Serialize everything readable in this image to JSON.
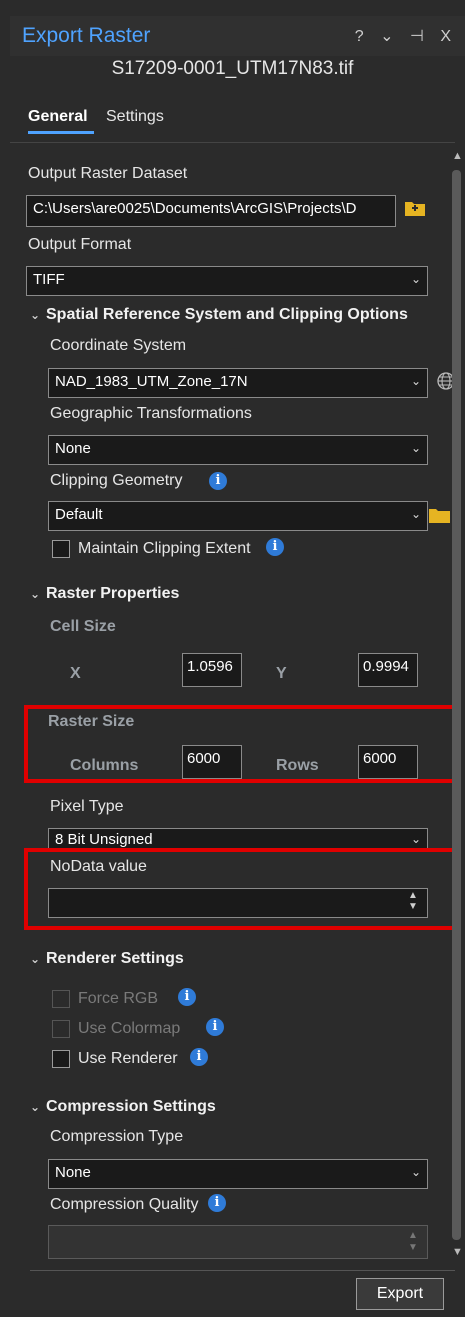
{
  "window": {
    "title": "Export Raster",
    "controls": "? ⌄ ⊣ X",
    "filename": "S17209-0001_UTM17N83.tif"
  },
  "tabs": [
    {
      "label": "General",
      "active": true
    },
    {
      "label": "Settings",
      "active": false
    }
  ],
  "output": {
    "raster_label": "Output Raster Dataset",
    "raster_value": "C:\\Users\\are0025\\Documents\\ArcGIS\\Projects\\D",
    "format_label": "Output Format",
    "format_value": "TIFF"
  },
  "spatial": {
    "section_label": "Spatial Reference System and Clipping Options",
    "coord_label": "Coordinate System",
    "coord_value": "NAD_1983_UTM_Zone_17N",
    "geo_label": "Geographic Transformations",
    "geo_value": "None",
    "clip_label": "Clipping Geometry",
    "clip_value": "Default",
    "maintain_label": "Maintain Clipping Extent"
  },
  "raster_props": {
    "section_label": "Raster Properties",
    "cell_size_label": "Cell Size",
    "x_label": "X",
    "x_value": "1.0596",
    "y_label": "Y",
    "y_value": "0.9994",
    "raster_size_label": "Raster Size",
    "columns_label": "Columns",
    "columns_value": "6000",
    "rows_label": "Rows",
    "rows_value": "6000",
    "pixel_type_label": "Pixel Type",
    "pixel_type_value": "8 Bit Unsigned",
    "nodata_label": "NoData value",
    "nodata_value": ""
  },
  "renderer": {
    "section_label": "Renderer Settings",
    "force_rgb_label": "Force RGB",
    "colormap_label": "Use Colormap",
    "use_renderer_label": "Use Renderer"
  },
  "compression": {
    "section_label": "Compression Settings",
    "type_label": "Compression Type",
    "type_value": "None",
    "quality_label": "Compression Quality",
    "quality_value": ""
  },
  "footer": {
    "export_label": "Export"
  },
  "colors": {
    "accent": "#4fa3ff",
    "highlight_box": "#e00000",
    "info_icon": "#2f7bd8",
    "folder_icon": "#e6b422"
  }
}
